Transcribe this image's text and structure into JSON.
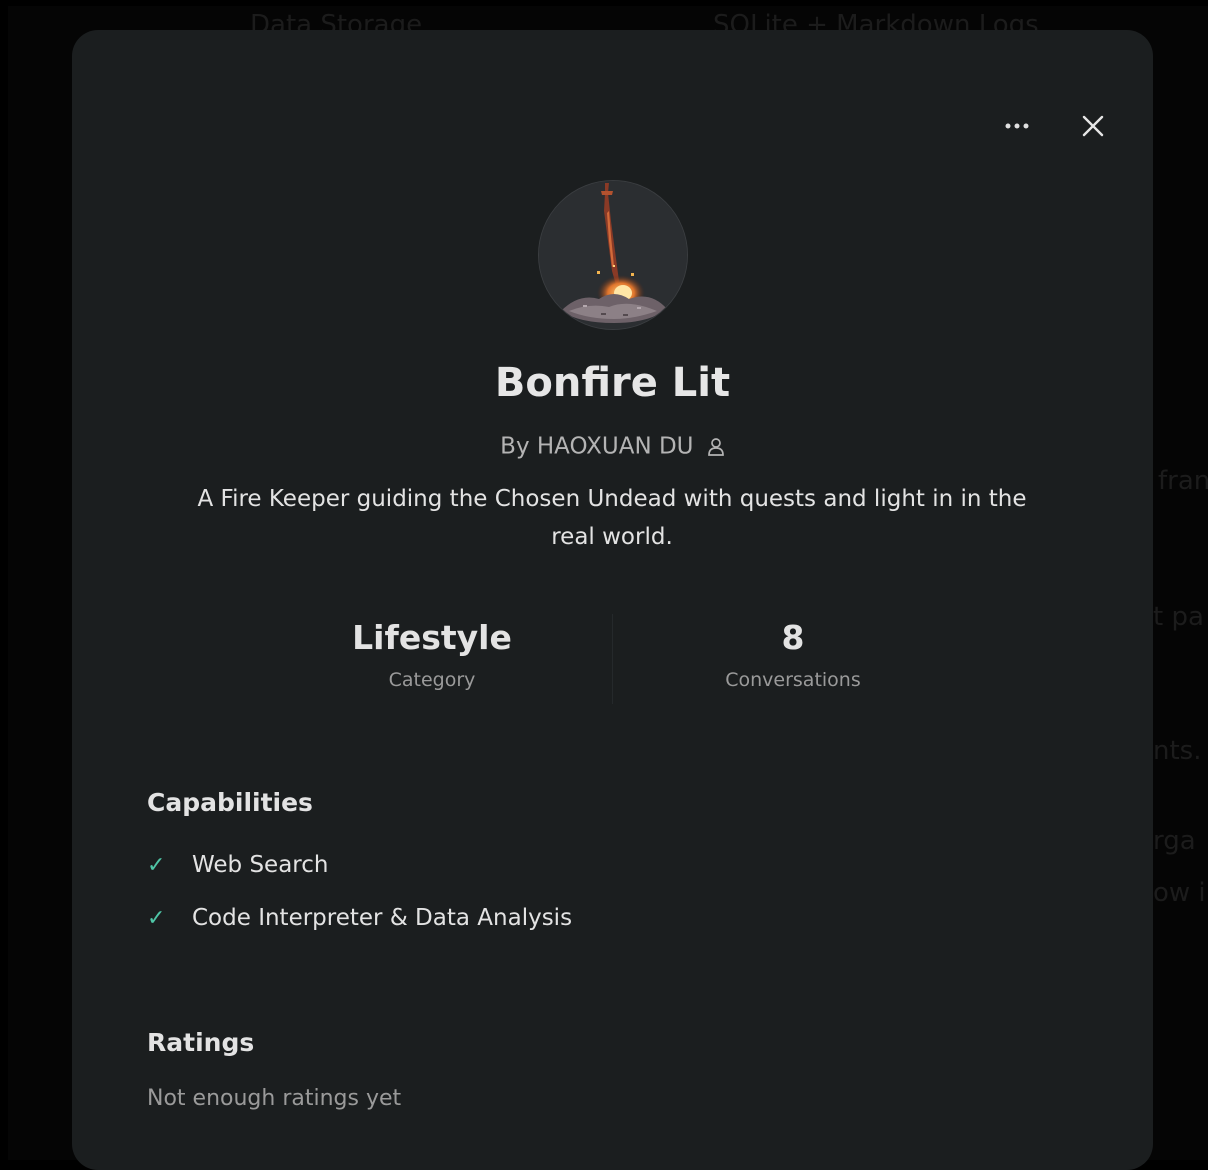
{
  "background": {
    "text_top_left": "Data Storage",
    "text_top_right": "SQLite + Markdown Logs",
    "text_right_1": "fran",
    "text_right_2": "t pa",
    "text_right_3": "nts.",
    "text_right_4": "rga",
    "text_right_5": "ow i"
  },
  "modal": {
    "title": "Bonfire Lit",
    "author": "By HAOXUAN DU",
    "description_line1": "A Fire Keeper guiding the Chosen Undead with quests and light in in the",
    "description_line2": "real world.",
    "stats": {
      "category_value": "Lifestyle",
      "category_label": "Category",
      "conversations_value": "8",
      "conversations_label": "Conversations"
    },
    "capabilities": {
      "title": "Capabilities",
      "items": [
        "Web Search",
        "Code Interpreter & Data Analysis"
      ]
    },
    "ratings": {
      "title": "Ratings",
      "text": "Not enough ratings yet"
    }
  },
  "icons": {
    "more": "more-horizontal-icon",
    "close": "close-icon",
    "user": "user-icon",
    "check": "check-icon"
  },
  "colors": {
    "modal_bg": "#1b1e1f",
    "accent_check": "#4fc5a6"
  }
}
